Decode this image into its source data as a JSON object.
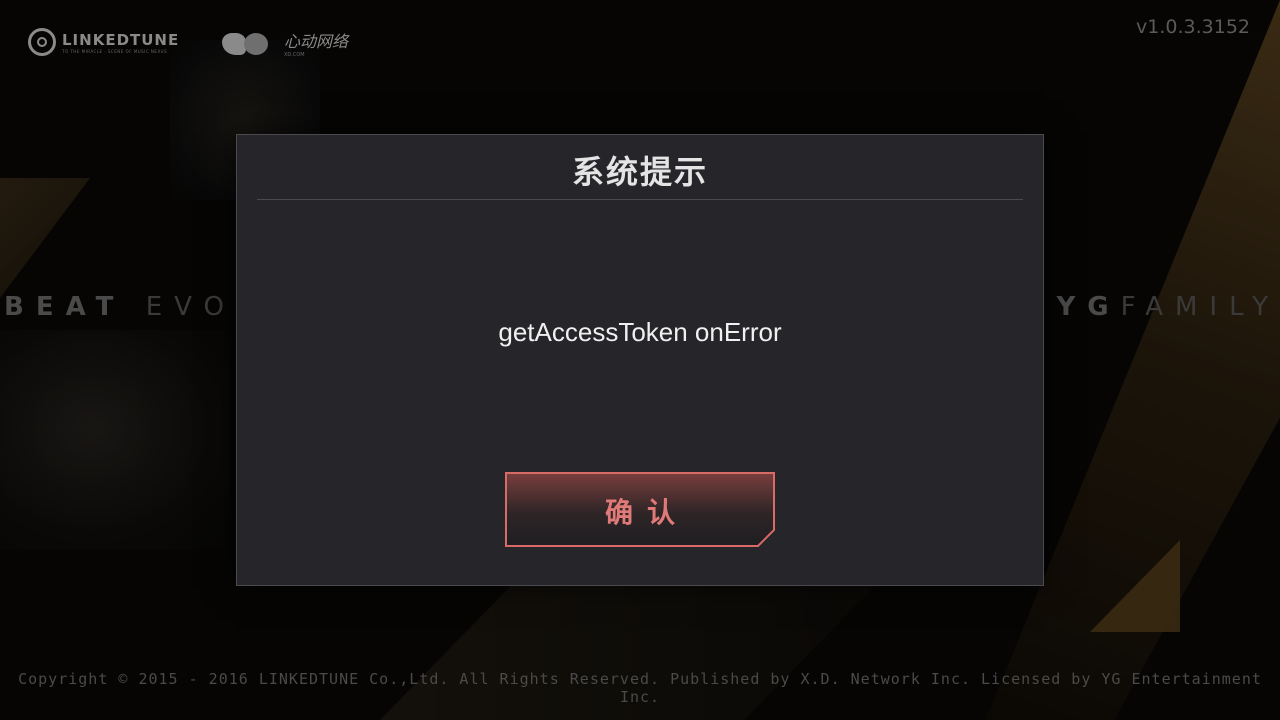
{
  "background": {
    "left_banner": {
      "strong": "BEAT",
      "light": "EVO"
    },
    "right_banner": {
      "strong": "YG",
      "light": "FAMILY"
    },
    "version": "v1.0.3.3152",
    "copyright": "Copyright © 2015 - 2016 LINKEDTUNE Co.,Ltd. All Rights Reserved. Published by X.D. Network Inc. Licensed by YG Entertainment Inc."
  },
  "logos": {
    "linkedtune": {
      "text": "LINKEDTUNE",
      "subtext": "TO THE MIRACLE · SCENE OF MUSIC NEXUS"
    },
    "xd": {
      "text": "心动网络",
      "subtext": "XD.COM"
    }
  },
  "dialog": {
    "title": "系统提示",
    "message": "getAccessToken onError",
    "confirm_label": "确认"
  },
  "colors": {
    "dialog_bg": "#26262a",
    "button_border": "#d86a68",
    "button_text": "#e07a78",
    "gold_accent": "#7a5a2a"
  }
}
